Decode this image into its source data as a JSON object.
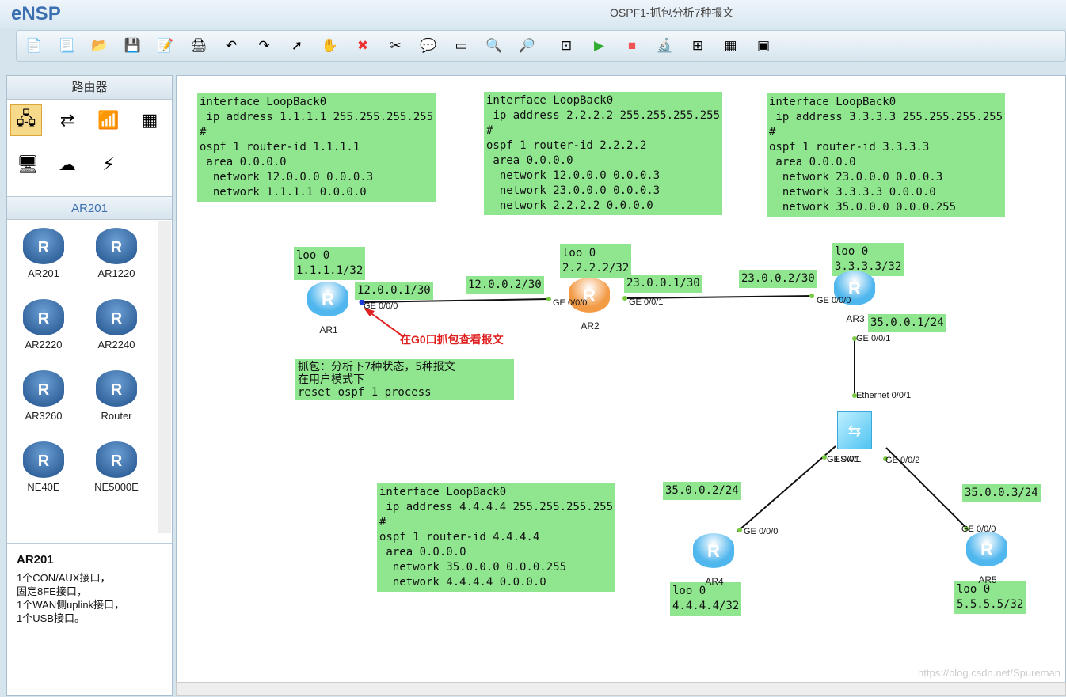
{
  "app": {
    "name": "eNSP",
    "title": "OSPF1-抓包分析7种报文"
  },
  "toolbar": {
    "icons": [
      "new-topology",
      "new-blank",
      "open",
      "save",
      "save-as",
      "print",
      "undo",
      "redo",
      "select",
      "pan",
      "delete",
      "delete-link",
      "text",
      "rectangle",
      "zoom-in",
      "zoom-out",
      "fit",
      "start",
      "stop",
      "capture",
      "topology",
      "grid",
      "console"
    ]
  },
  "sidebar": {
    "category_title": "路由器",
    "subtitle": "AR201",
    "devices": [
      {
        "label": "AR201"
      },
      {
        "label": "AR1220"
      },
      {
        "label": "AR2220"
      },
      {
        "label": "AR2240"
      },
      {
        "label": "AR3260"
      },
      {
        "label": "Router"
      },
      {
        "label": "NE40E"
      },
      {
        "label": "NE5000E"
      }
    ],
    "description": {
      "title": "AR201",
      "lines": [
        "1个CON/AUX接口，",
        "固定8FE接口，",
        "1个WAN侧uplink接口，",
        "1个USB接口。"
      ]
    }
  },
  "notes": {
    "ar1": "interface LoopBack0\n ip address 1.1.1.1 255.255.255.255\n#\nospf 1 router-id 1.1.1.1\n area 0.0.0.0\n  network 12.0.0.0 0.0.0.3\n  network 1.1.1.1 0.0.0.0",
    "ar2": "interface LoopBack0\n ip address 2.2.2.2 255.255.255.255\n#\nospf 1 router-id 2.2.2.2\n area 0.0.0.0\n  network 12.0.0.0 0.0.0.3\n  network 23.0.0.0 0.0.0.3\n  network 2.2.2.2 0.0.0.0",
    "ar3": "interface LoopBack0\n ip address 3.3.3.3 255.255.255.255\n#\nospf 1 router-id 3.3.3.3\n area 0.0.0.0\n  network 23.0.0.0 0.0.0.3\n  network 3.3.3.3 0.0.0.0\n  network 35.0.0.0 0.0.0.255",
    "ar4": "interface LoopBack0\n ip address 4.4.4.4 255.255.255.255\n#\nospf 1 router-id 4.4.4.4\n area 0.0.0.0\n  network 35.0.0.0 0.0.0.255\n  network 4.4.4.4 0.0.0.0",
    "capture": "抓包：分析下7种状态，5种报文\n在用户模式下\nreset ospf 1 process",
    "loo1": "loo 0\n1.1.1.1/32",
    "loo2": "loo 0\n2.2.2.2/32",
    "loo3": "loo 0\n3.3.3.3/32",
    "loo4": "loo 0\n4.4.4.4/32",
    "loo5": "loo 0\n5.5.5.5/32",
    "ip1": "12.0.0.1/30",
    "ip2": "12.0.0.2/30",
    "ip3": "23.0.0.1/30",
    "ip4": "23.0.0.2/30",
    "ip5": "35.0.0.1/24",
    "ip6": "35.0.0.2/24",
    "ip7": "35.0.0.3/24"
  },
  "topology": {
    "routers": [
      "AR1",
      "AR2",
      "AR3",
      "AR4",
      "AR5"
    ],
    "switch": "LSW1",
    "ports": {
      "ar1": "GE 0/0/0",
      "ar2a": "GE 0/0/0",
      "ar2b": "GE 0/0/1",
      "ar3a": "GE 0/0/0",
      "ar3b": "GE 0/0/1",
      "sw1": "Ethernet 0/0/1",
      "sw2": "GE 0/0/1",
      "sw3": "GE 0/0/2",
      "ar4": "GE 0/0/0",
      "ar5": "GE 0/0/0"
    },
    "annotation": "在G0口抓包查看报文",
    "annotation_color": "#e02020"
  },
  "watermark": "https://blog.csdn.net/Spureman"
}
